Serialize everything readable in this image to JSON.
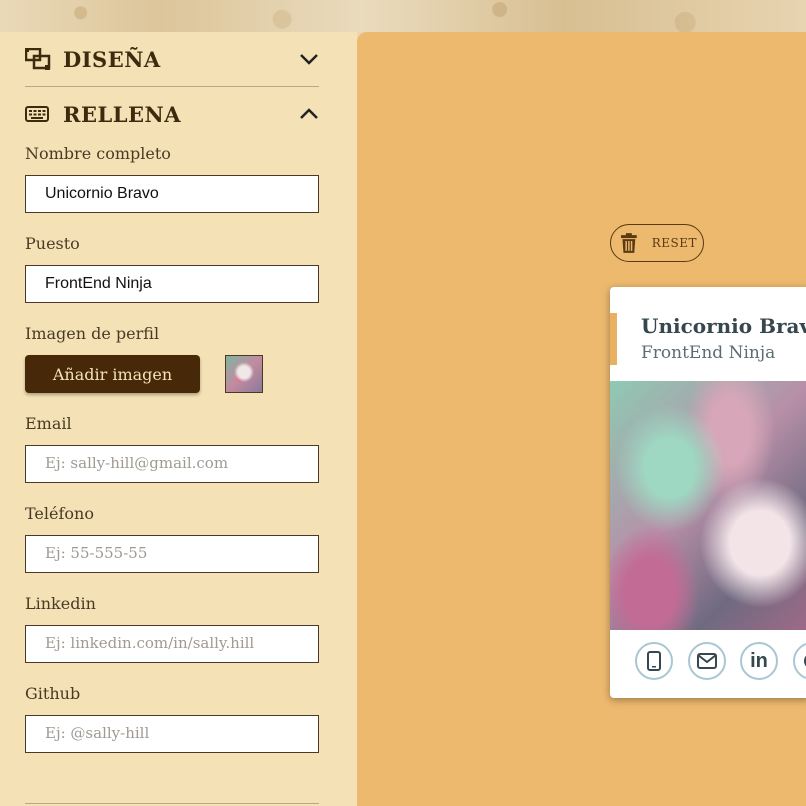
{
  "sections": {
    "design": {
      "title": "DISEÑA",
      "icon": "object-group-icon",
      "state": "collapsed"
    },
    "fill": {
      "title": "RELLENA",
      "icon": "keyboard-icon",
      "state": "expanded"
    }
  },
  "form": {
    "name": {
      "label": "Nombre completo",
      "value": "Unicornio Bravo",
      "placeholder": ""
    },
    "job": {
      "label": "Puesto",
      "value": "FrontEnd Ninja",
      "placeholder": ""
    },
    "image": {
      "label": "Imagen de perfil",
      "button": "Añadir imagen"
    },
    "email": {
      "label": "Email",
      "value": "",
      "placeholder": "Ej: sally-hill@gmail.com"
    },
    "phone": {
      "label": "Teléfono",
      "value": "",
      "placeholder": "Ej: 55-555-55"
    },
    "linkedin": {
      "label": "Linkedin",
      "value": "",
      "placeholder": "Ej: linkedin.com/in/sally.hill"
    },
    "github": {
      "label": "Github",
      "value": "",
      "placeholder": "Ej: @sally-hill"
    }
  },
  "preview": {
    "reset_label": "RESET",
    "card": {
      "name": "Unicornio Bravo",
      "job": "FrontEnd Ninja",
      "socials": [
        "phone-icon",
        "envelope-icon",
        "linkedin-icon",
        "github-icon"
      ],
      "linkedin_text": "in"
    }
  },
  "colors": {
    "panel": "#f4e2b6",
    "preview_bg": "#ecb96e",
    "accent": "#47290a",
    "card_bar": "#e8b060"
  }
}
